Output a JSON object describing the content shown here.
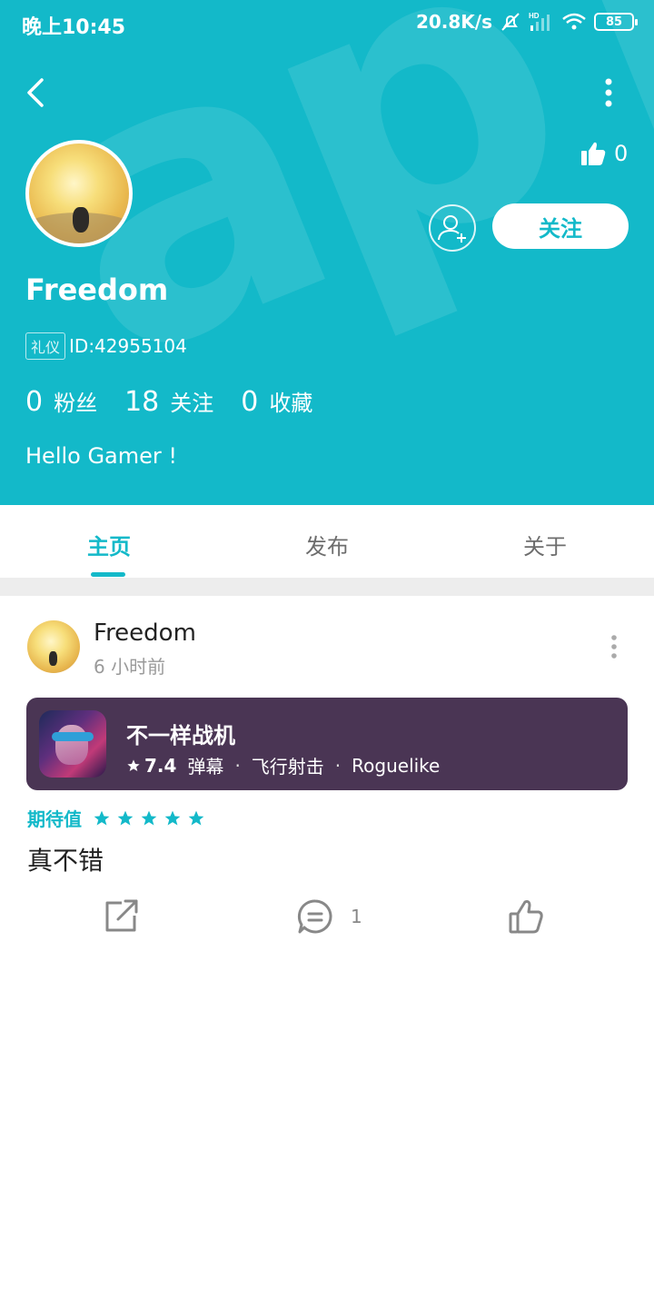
{
  "status_bar": {
    "time": "晚上10:45",
    "net_speed": "20.8K/s",
    "hd_label": "HD",
    "battery": "85"
  },
  "header": {
    "like_count": "0",
    "follow_label": "关注",
    "username": "Freedom",
    "id_tag": "礼仪",
    "id_text": "ID:42955104",
    "stats": [
      {
        "num": "0",
        "label": "粉丝"
      },
      {
        "num": "18",
        "label": "关注"
      },
      {
        "num": "0",
        "label": "收藏"
      }
    ],
    "bio": "Hello Gamer !",
    "accent": "#13b9c9"
  },
  "tabs": [
    "主页",
    "发布",
    "关于"
  ],
  "post": {
    "author": "Freedom",
    "time": "6 小时前",
    "game": {
      "title": "不一样战机",
      "rating": "7.4",
      "tags": [
        "弹幕",
        "飞行射击",
        "Roguelike"
      ]
    },
    "expect_label": "期待值",
    "expect_stars": 5,
    "text": "真不错",
    "comment_count": "1"
  }
}
